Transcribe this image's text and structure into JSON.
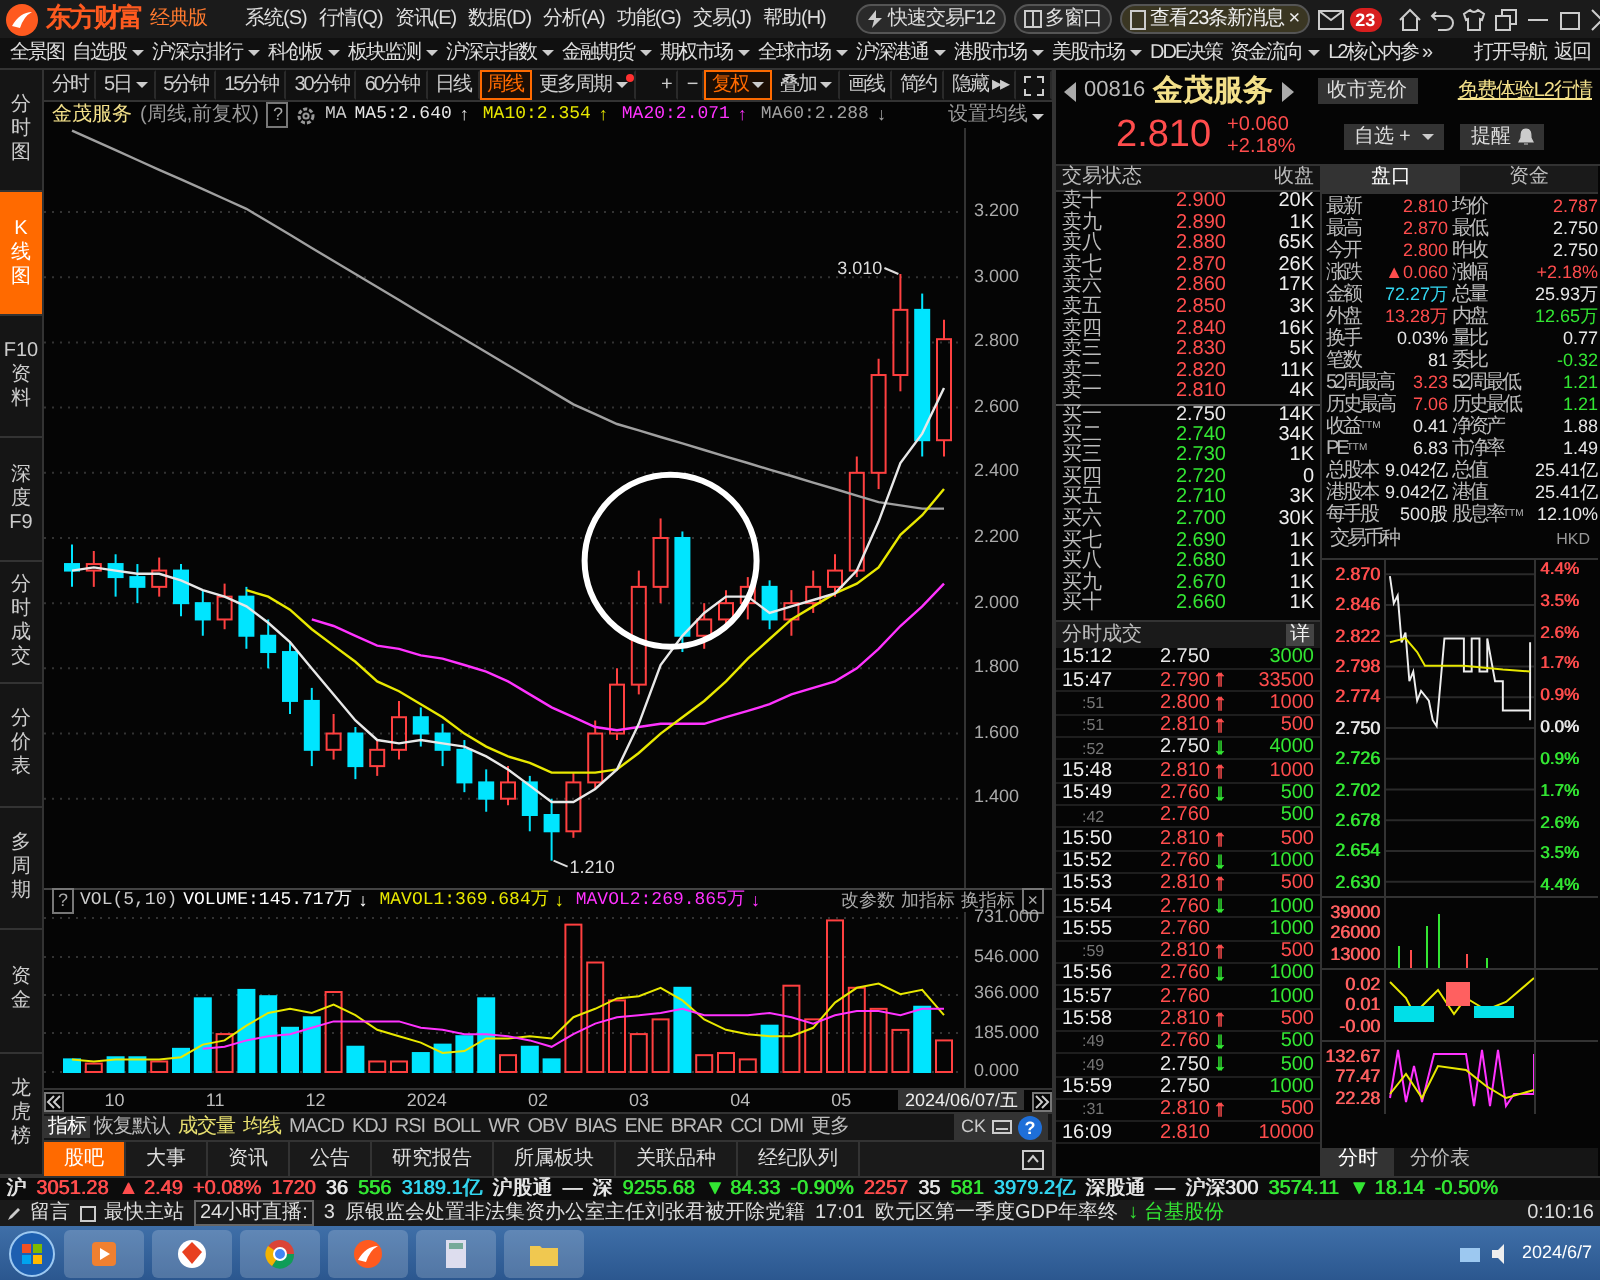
{
  "top_bar": {
    "brand": "东方财富",
    "edition": "经典版",
    "menu": [
      "系统(S)",
      "行情(Q)",
      "资讯(E)",
      "数据(D)",
      "分析(A)",
      "功能(G)",
      "交易(J)",
      "帮助(H)"
    ],
    "quick_trade": "快速交易F12",
    "multi_window": "多窗口",
    "messages": "查看23条新消息",
    "messages_close": "×",
    "mail_badge": "23"
  },
  "nav": [
    {
      "label": "全景图",
      "dropdown": false
    },
    {
      "label": "自选股",
      "dropdown": true
    },
    {
      "label": "沪深京排行",
      "dropdown": true
    },
    {
      "label": "科创板",
      "dropdown": true
    },
    {
      "label": "板块监测",
      "dropdown": true
    },
    {
      "label": "沪深京指数",
      "dropdown": true
    },
    {
      "label": "金融期货",
      "dropdown": true
    },
    {
      "label": "期权市场",
      "dropdown": true
    },
    {
      "label": "全球市场",
      "dropdown": true
    },
    {
      "label": "沪深港通",
      "dropdown": true
    },
    {
      "label": "港股市场",
      "dropdown": true
    },
    {
      "label": "美股市场",
      "dropdown": true
    },
    {
      "label": "DDE决策",
      "dropdown": false
    },
    {
      "label": "资金流向",
      "dropdown": true
    },
    {
      "label": "L2核心内参 »",
      "dropdown": false
    },
    {
      "label": "打开导航",
      "dropdown": false
    },
    {
      "label": "返回",
      "dropdown": false
    }
  ],
  "sidebar": [
    {
      "label": "分时图",
      "selected": false
    },
    {
      "label": "K线图",
      "selected": true
    },
    {
      "label": "F10资料",
      "selected": false
    },
    {
      "label": "深度F9",
      "selected": false
    },
    {
      "label": "分时成交",
      "selected": false
    },
    {
      "label": "分价表",
      "selected": false
    },
    {
      "label": "多周期",
      "selected": false
    },
    {
      "label": "资金",
      "selected": false
    },
    {
      "label": "龙虎榜",
      "selected": false
    }
  ],
  "periods": [
    {
      "label": "分时",
      "dropdown": false,
      "selected": false,
      "new_dot": false
    },
    {
      "label": "5日",
      "dropdown": true,
      "selected": false,
      "new_dot": false
    },
    {
      "label": "5分钟",
      "dropdown": false,
      "selected": false,
      "new_dot": false
    },
    {
      "label": "15分钟",
      "dropdown": false,
      "selected": false,
      "new_dot": false
    },
    {
      "label": "30分钟",
      "dropdown": false,
      "selected": false,
      "new_dot": false
    },
    {
      "label": "60分钟",
      "dropdown": false,
      "selected": false,
      "new_dot": false
    },
    {
      "label": "日线",
      "dropdown": false,
      "selected": false,
      "new_dot": false
    },
    {
      "label": "周线",
      "dropdown": false,
      "selected": true,
      "new_dot": false
    },
    {
      "label": "更多周期",
      "dropdown": true,
      "selected": false,
      "new_dot": true
    }
  ],
  "tools": [
    {
      "label": "+",
      "dropdown": false,
      "selected": false
    },
    {
      "label": "−",
      "dropdown": false,
      "selected": false
    },
    {
      "label": "复权",
      "dropdown": true,
      "selected": true
    },
    {
      "label": "叠加",
      "dropdown": true,
      "selected": false
    },
    {
      "label": "画线",
      "dropdown": false,
      "selected": false
    },
    {
      "label": "简约",
      "dropdown": false,
      "selected": false
    },
    {
      "label": "隐藏 ▸▸",
      "dropdown": false,
      "selected": false
    }
  ],
  "legend": {
    "name": "金茂服务",
    "mode": "(周线,前复权)",
    "help": "?",
    "ma_label": "MA",
    "mas": [
      {
        "value": ":2.640",
        "arrow": "↑"
      },
      {
        "value": ":2.354",
        "arrow": "↑"
      },
      {
        "value": ":2.071",
        "arrow": "↑"
      },
      {
        "value": ":2.288",
        "arrow": "↓"
      }
    ],
    "settings": "设置均线"
  },
  "kline": {
    "high_label": "3.010",
    "low_label": "1.210",
    "annotation": {
      "kind": "circle"
    },
    "chart_data": {
      "type": "candlestick",
      "grid": true,
      "ylim": [
        1.126,
        3.458
      ],
      "yticks": [
        {
          "value": 3.2,
          "label": "3.200"
        },
        {
          "value": 3.0,
          "label": "3.000"
        },
        {
          "value": 2.8,
          "label": "2.800"
        },
        {
          "value": 2.6,
          "label": "2.600"
        },
        {
          "value": 2.4,
          "label": "2.400"
        },
        {
          "value": 2.2,
          "label": "2.200"
        },
        {
          "value": 2.0,
          "label": "2.000"
        },
        {
          "value": 1.8,
          "label": "1.800"
        },
        {
          "value": 1.6,
          "label": "1.600"
        },
        {
          "value": 1.4,
          "label": "1.400"
        }
      ],
      "ohlc": [
        [
          2.12,
          2.18,
          2.05,
          2.1
        ],
        [
          2.1,
          2.16,
          2.05,
          2.12
        ],
        [
          2.12,
          2.15,
          2.02,
          2.08
        ],
        [
          2.08,
          2.12,
          2.0,
          2.05
        ],
        [
          2.05,
          2.14,
          2.02,
          2.1
        ],
        [
          2.1,
          2.12,
          1.96,
          2.0
        ],
        [
          2.0,
          2.04,
          1.9,
          1.95
        ],
        [
          1.95,
          2.06,
          1.92,
          2.02
        ],
        [
          2.02,
          2.05,
          1.86,
          1.9
        ],
        [
          1.9,
          1.95,
          1.8,
          1.85
        ],
        [
          1.85,
          1.88,
          1.66,
          1.7
        ],
        [
          1.7,
          1.74,
          1.5,
          1.55
        ],
        [
          1.55,
          1.66,
          1.52,
          1.6
        ],
        [
          1.6,
          1.62,
          1.46,
          1.5
        ],
        [
          1.5,
          1.58,
          1.47,
          1.55
        ],
        [
          1.55,
          1.7,
          1.52,
          1.65
        ],
        [
          1.65,
          1.68,
          1.56,
          1.6
        ],
        [
          1.6,
          1.63,
          1.5,
          1.55
        ],
        [
          1.55,
          1.58,
          1.42,
          1.45
        ],
        [
          1.45,
          1.49,
          1.36,
          1.4
        ],
        [
          1.4,
          1.5,
          1.38,
          1.45
        ],
        [
          1.45,
          1.47,
          1.3,
          1.35
        ],
        [
          1.35,
          1.4,
          1.21,
          1.3
        ],
        [
          1.3,
          1.48,
          1.28,
          1.45
        ],
        [
          1.45,
          1.64,
          1.43,
          1.6
        ],
        [
          1.6,
          1.8,
          1.58,
          1.75
        ],
        [
          1.75,
          2.1,
          1.72,
          2.05
        ],
        [
          2.05,
          2.26,
          2.0,
          2.2
        ],
        [
          2.2,
          2.22,
          1.85,
          1.9
        ],
        [
          1.9,
          2.0,
          1.86,
          1.95
        ],
        [
          1.95,
          2.04,
          1.92,
          2.0
        ],
        [
          2.0,
          2.08,
          1.95,
          2.05
        ],
        [
          2.05,
          2.07,
          1.92,
          1.95
        ],
        [
          1.95,
          2.04,
          1.9,
          2.0
        ],
        [
          2.0,
          2.1,
          1.97,
          2.05
        ],
        [
          2.05,
          2.15,
          2.02,
          2.1
        ],
        [
          2.1,
          2.45,
          2.08,
          2.4
        ],
        [
          2.4,
          2.75,
          2.35,
          2.7
        ],
        [
          2.7,
          3.01,
          2.65,
          2.9
        ],
        [
          2.9,
          2.95,
          2.45,
          2.5
        ],
        [
          2.5,
          2.87,
          2.45,
          2.81
        ]
      ],
      "series": [
        {
          "name": "MA5",
          "type": "line",
          "color": "#e8e8e8",
          "values": [
            2.1,
            2.11,
            2.1,
            2.09,
            2.09,
            2.07,
            2.04,
            2.02,
            1.99,
            1.94,
            1.88,
            1.8,
            1.72,
            1.64,
            1.58,
            1.57,
            1.58,
            1.57,
            1.56,
            1.53,
            1.49,
            1.44,
            1.39,
            1.39,
            1.43,
            1.49,
            1.63,
            1.81,
            1.9,
            1.97,
            2.02,
            2.02,
            1.97,
            1.99,
            2.01,
            2.03,
            2.1,
            2.25,
            2.43,
            2.52,
            2.66
          ]
        },
        {
          "name": "MA10",
          "type": "line",
          "color": "#e8e800",
          "values": [
            null,
            null,
            null,
            null,
            null,
            null,
            null,
            null,
            2.04,
            2.02,
            1.98,
            1.92,
            1.87,
            1.82,
            1.76,
            1.73,
            1.69,
            1.65,
            1.6,
            1.56,
            1.53,
            1.51,
            1.48,
            1.48,
            1.48,
            1.49,
            1.54,
            1.6,
            1.65,
            1.7,
            1.76,
            1.83,
            1.89,
            1.95,
            1.99,
            2.03,
            2.06,
            2.11,
            2.21,
            2.27,
            2.35
          ]
        },
        {
          "name": "MA20",
          "type": "line",
          "color": "#ff33ff",
          "values": [
            null,
            null,
            null,
            null,
            null,
            null,
            null,
            null,
            null,
            null,
            null,
            1.95,
            1.93,
            1.9,
            1.87,
            1.86,
            1.84,
            1.83,
            1.81,
            1.79,
            1.76,
            1.72,
            1.68,
            1.65,
            1.62,
            1.61,
            1.62,
            1.63,
            1.63,
            1.63,
            1.65,
            1.67,
            1.69,
            1.72,
            1.74,
            1.76,
            1.8,
            1.86,
            1.93,
            1.99,
            2.06
          ]
        },
        {
          "name": "MA60",
          "type": "line",
          "color": "#a0a0a0",
          "values": [
            3.45,
            3.42,
            3.39,
            3.36,
            3.33,
            3.3,
            3.27,
            3.24,
            3.21,
            3.17,
            3.13,
            3.09,
            3.05,
            3.01,
            2.97,
            2.93,
            2.89,
            2.85,
            2.81,
            2.77,
            2.73,
            2.69,
            2.65,
            2.61,
            2.58,
            2.55,
            2.53,
            2.51,
            2.49,
            2.47,
            2.45,
            2.43,
            2.41,
            2.39,
            2.37,
            2.35,
            2.33,
            2.31,
            2.3,
            2.29,
            2.29
          ]
        }
      ]
    }
  },
  "volume": {
    "help": "?",
    "title": "VOL(5,10)",
    "items": [
      {
        "value": ":145.717万",
        "arrow": "↓"
      },
      {
        "value": ":369.684万",
        "arrow": "↓"
      },
      {
        "value": ":269.865万",
        "arrow": "↓"
      }
    ],
    "actions": [
      "改参数",
      "加指标",
      "换指标"
    ],
    "close": "×",
    "chart_data": {
      "type": "bar",
      "grid": true,
      "ylim": [
        0,
        760
      ],
      "yticks": [
        {
          "value": 731,
          "label": "731.000"
        },
        {
          "value": 546,
          "label": "546.000"
        },
        {
          "value": 366,
          "label": "366.000"
        },
        {
          "value": 185,
          "label": "185.000"
        },
        {
          "value": 0,
          "label": "0.000"
        }
      ],
      "series": [
        {
          "name": "VOLUME",
          "colors": [
            "#00e5ff",
            "#ff4040",
            "#00e5ff",
            "#00e5ff",
            "#ff4040",
            "#00e5ff",
            "#00e5ff",
            "#ff4040",
            "#00e5ff",
            "#00e5ff",
            "#00e5ff",
            "#00e5ff",
            "#ff4040",
            "#00e5ff",
            "#ff4040",
            "#ff4040",
            "#00e5ff",
            "#00e5ff",
            "#00e5ff",
            "#00e5ff",
            "#ff4040",
            "#00e5ff",
            "#00e5ff",
            "#ff4040",
            "#ff4040",
            "#ff4040",
            "#ff4040",
            "#ff4040",
            "#00e5ff",
            "#ff4040",
            "#ff4040",
            "#ff4040",
            "#00e5ff",
            "#ff4040",
            "#ff4040",
            "#ff4040",
            "#ff4040",
            "#ff4040",
            "#ff4040",
            "#00e5ff",
            "#ff4040"
          ],
          "values": [
            60,
            40,
            70,
            70,
            50,
            110,
            350,
            180,
            390,
            360,
            210,
            260,
            380,
            120,
            50,
            50,
            90,
            130,
            170,
            350,
            80,
            120,
            60,
            700,
            520,
            340,
            180,
            250,
            400,
            80,
            90,
            60,
            220,
            410,
            250,
            720,
            400,
            300,
            200,
            310,
            150
          ]
        },
        {
          "name": "MAVOL1",
          "type": "line",
          "color": "#e8e800",
          "values": [
            60,
            50,
            60,
            60,
            60,
            70,
            130,
            150,
            220,
            280,
            300,
            280,
            320,
            270,
            200,
            170,
            140,
            90,
            100,
            160,
            160,
            170,
            160,
            260,
            300,
            350,
            360,
            400,
            340,
            250,
            200,
            180,
            170,
            170,
            210,
            330,
            400,
            420,
            370,
            390,
            270
          ]
        },
        {
          "name": "MAVOL2",
          "type": "line",
          "color": "#ff33ff",
          "values": [
            null,
            null,
            null,
            null,
            null,
            null,
            110,
            120,
            150,
            170,
            180,
            210,
            240,
            240,
            240,
            240,
            210,
            200,
            180,
            180,
            170,
            150,
            120,
            180,
            230,
            260,
            270,
            280,
            300,
            270,
            270,
            270,
            280,
            260,
            230,
            270,
            290,
            290,
            270,
            300,
            300
          ]
        }
      ]
    }
  },
  "x_labels": [
    "10",
    "11",
    "12",
    "2024",
    "02",
    "03",
    "04",
    "05"
  ],
  "cursor_date": "2024/06/07/五",
  "indicator_tabs": [
    {
      "label": "指标",
      "selected": true
    },
    {
      "label": "恢复默认",
      "selected": false
    },
    {
      "label": "成交量",
      "selected": false
    },
    {
      "label": "均线",
      "selected": false
    },
    {
      "label": "MACD",
      "selected": false
    },
    {
      "label": "KDJ",
      "selected": false
    },
    {
      "label": "RSI",
      "selected": false
    },
    {
      "label": "BOLL",
      "selected": false
    },
    {
      "label": "WR",
      "selected": false
    },
    {
      "label": "OBV",
      "selected": false
    },
    {
      "label": "BIAS",
      "selected": false
    },
    {
      "label": "ENE",
      "selected": false
    },
    {
      "label": "BRAR",
      "selected": false
    },
    {
      "label": "CCI",
      "selected": false
    },
    {
      "label": "DMI",
      "selected": false
    },
    {
      "label": "更多",
      "selected": false
    }
  ],
  "ck_widget": {
    "label": "CK",
    "help": "?"
  },
  "bottom_tabs": [
    {
      "label": "股吧",
      "selected": true
    },
    {
      "label": "大事",
      "selected": false
    },
    {
      "label": "资讯",
      "selected": false
    },
    {
      "label": "公告",
      "selected": false
    },
    {
      "label": "研究报告",
      "selected": false
    },
    {
      "label": "所属板块",
      "selected": false
    },
    {
      "label": "关联品种",
      "selected": false
    },
    {
      "label": "经纪队列",
      "selected": false
    }
  ],
  "quote": {
    "code": "00816",
    "name": "金茂服务",
    "auction": "收市竞价",
    "l2_link": "免费体验L2行情",
    "price": "2.810",
    "change": "+0.060",
    "change_pct": "+2.18%",
    "watch": "自选 +",
    "alert": "提醒"
  },
  "order_book": {
    "status_label": "交易状态",
    "status": "收盘",
    "asks": [
      {
        "label": "卖十",
        "price": "2.900",
        "volume": "20K",
        "color": "#ff4d4d"
      },
      {
        "label": "卖九",
        "price": "2.890",
        "volume": "1K",
        "color": "#ff4d4d"
      },
      {
        "label": "卖八",
        "price": "2.880",
        "volume": "65K",
        "color": "#ff4d4d"
      },
      {
        "label": "卖七",
        "price": "2.870",
        "volume": "26K",
        "color": "#ff4d4d"
      },
      {
        "label": "卖六",
        "price": "2.860",
        "volume": "17K",
        "color": "#ff4d4d"
      },
      {
        "label": "卖五",
        "price": "2.850",
        "volume": "3K",
        "color": "#ff4d4d"
      },
      {
        "label": "卖四",
        "price": "2.840",
        "volume": "16K",
        "color": "#ff4d4d"
      },
      {
        "label": "卖三",
        "price": "2.830",
        "volume": "5K",
        "color": "#ff4d4d"
      },
      {
        "label": "卖二",
        "price": "2.820",
        "volume": "11K",
        "color": "#ff4d4d"
      },
      {
        "label": "卖一",
        "price": "2.810",
        "volume": "4K",
        "color": "#ff4d4d"
      }
    ],
    "bids": [
      {
        "label": "买一",
        "price": "2.750",
        "volume": "14K",
        "color": "#e6e6e6"
      },
      {
        "label": "买二",
        "price": "2.740",
        "volume": "34K",
        "color": "#33e633"
      },
      {
        "label": "买三",
        "price": "2.730",
        "volume": "1K",
        "color": "#33e633"
      },
      {
        "label": "买四",
        "price": "2.720",
        "volume": "0",
        "color": "#33e633"
      },
      {
        "label": "买五",
        "price": "2.710",
        "volume": "3K",
        "color": "#33e633"
      },
      {
        "label": "买六",
        "price": "2.700",
        "volume": "30K",
        "color": "#33e633"
      },
      {
        "label": "买七",
        "price": "2.690",
        "volume": "1K",
        "color": "#33e633"
      },
      {
        "label": "买八",
        "price": "2.680",
        "volume": "1K",
        "color": "#33e633"
      },
      {
        "label": "买九",
        "price": "2.670",
        "volume": "1K",
        "color": "#33e633"
      },
      {
        "label": "买十",
        "price": "2.660",
        "volume": "1K",
        "color": "#33e633"
      }
    ]
  },
  "stats_tabs": [
    {
      "label": "盘口",
      "selected": true
    },
    {
      "label": "资金",
      "selected": false
    }
  ],
  "stats": [
    {
      "label": "最新",
      "value": "2.810",
      "color": "#ff4d4d"
    },
    {
      "label": "均价",
      "value": "2.787",
      "color": "#ff4d4d"
    },
    {
      "label": "最高",
      "value": "2.870",
      "color": "#ff4d4d"
    },
    {
      "label": "最低",
      "value": "2.750",
      "color": "#e6e6e6"
    },
    {
      "label": "今开",
      "value": "2.800",
      "color": "#ff4d4d"
    },
    {
      "label": "昨收",
      "value": "2.750",
      "color": "#e6e6e6"
    },
    {
      "label": "涨跌",
      "value": "▲0.060",
      "color": "#ff4d4d"
    },
    {
      "label": "涨幅",
      "value": "+2.18%",
      "color": "#ff4d4d"
    },
    {
      "label": "金额",
      "value": "72.27万",
      "color": "#33d6f0"
    },
    {
      "label": "总量",
      "value": "25.93万",
      "color": "#e6e6e6"
    },
    {
      "label": "外盘",
      "value": "13.28万",
      "color": "#ff4d4d"
    },
    {
      "label": "内盘",
      "value": "12.65万",
      "color": "#33e633"
    },
    {
      "label": "换手",
      "value": "0.03%",
      "color": "#e6e6e6"
    },
    {
      "label": "量比",
      "value": "0.77",
      "color": "#e6e6e6"
    },
    {
      "label": "笔数",
      "value": "81",
      "color": "#e6e6e6"
    },
    {
      "label": "委比",
      "value": "-0.32",
      "color": "#33e633"
    },
    {
      "label": "52周最高",
      "value": "3.23",
      "color": "#ff4d4d"
    },
    {
      "label": "52周最低",
      "value": "1.21",
      "color": "#33e633"
    },
    {
      "label": "历史最高",
      "value": "7.06",
      "color": "#ff4d4d"
    },
    {
      "label": "历史最低",
      "value": "1.21",
      "color": "#33e633"
    },
    {
      "label": "收益$^{TTM}$",
      "value": "0.41",
      "color": "#e6e6e6"
    },
    {
      "label": "净资产",
      "value": "1.88",
      "color": "#e6e6e6"
    },
    {
      "label": "PE$^{TTM}$",
      "value": "6.83",
      "color": "#e6e6e6"
    },
    {
      "label": "市净率",
      "value": "1.49",
      "color": "#e6e6e6"
    },
    {
      "label": "总股本",
      "value": "9.042亿",
      "color": "#e6e6e6"
    },
    {
      "label": "总值",
      "value": "25.41亿",
      "color": "#e6e6e6"
    },
    {
      "label": "港股本",
      "value": "9.042亿",
      "color": "#e6e6e6"
    },
    {
      "label": "港值",
      "value": "25.41亿",
      "color": "#e6e6e6"
    },
    {
      "label": "每手股",
      "value": "500股",
      "color": "#e6e6e6"
    },
    {
      "label": "股息率$^{TTM}$",
      "value": "12.10%",
      "color": "#e6e6e6"
    }
  ],
  "currency": {
    "label": "交易币种",
    "value": "HKD"
  },
  "trades_header": {
    "title": "分时成交",
    "detail": "详"
  },
  "trades": [
    {
      "time": "15:12",
      "sub": false,
      "price": "2.750",
      "color": "#e6e6e6",
      "volume": {
        "text": "3000",
        "color": "#33e633"
      }
    },
    {
      "time": "15:47",
      "sub": false,
      "price": "2.790",
      "color": "#ff4d4d",
      "arrow": {
        "text": "↑",
        "color": "#ff4d4d"
      },
      "volume": {
        "text": "33500",
        "color": "#ff4d4d"
      }
    },
    {
      "time": ":51",
      "sub": true,
      "price": "2.800",
      "color": "#ff4d4d",
      "arrow": {
        "text": "↑",
        "color": "#ff4d4d"
      },
      "volume": {
        "text": "1000",
        "color": "#ff4d4d"
      }
    },
    {
      "time": ":51",
      "sub": true,
      "price": "2.810",
      "color": "#ff4d4d",
      "arrow": {
        "text": "↑",
        "color": "#ff4d4d"
      },
      "volume": {
        "text": "500",
        "color": "#ff4d4d"
      }
    },
    {
      "time": ":52",
      "sub": true,
      "price": "2.750",
      "color": "#e6e6e6",
      "arrow": {
        "text": "↓",
        "color": "#33e633"
      },
      "volume": {
        "text": "4000",
        "color": "#33e633"
      }
    },
    {
      "time": "15:48",
      "sub": false,
      "price": "2.810",
      "color": "#ff4d4d",
      "arrow": {
        "text": "↑",
        "color": "#ff4d4d"
      },
      "volume": {
        "text": "1000",
        "color": "#ff4d4d"
      }
    },
    {
      "time": "15:49",
      "sub": false,
      "price": "2.760",
      "color": "#ff4d4d",
      "arrow": {
        "text": "↓",
        "color": "#33e633"
      },
      "volume": {
        "text": "500",
        "color": "#33e633"
      }
    },
    {
      "time": ":42",
      "sub": true,
      "price": "2.760",
      "color": "#ff4d4d",
      "volume": {
        "text": "500",
        "color": "#33e633"
      }
    },
    {
      "time": "15:50",
      "sub": false,
      "price": "2.810",
      "color": "#ff4d4d",
      "arrow": {
        "text": "↑",
        "color": "#ff4d4d"
      },
      "volume": {
        "text": "500",
        "color": "#ff4d4d"
      }
    },
    {
      "time": "15:52",
      "sub": false,
      "price": "2.760",
      "color": "#ff4d4d",
      "arrow": {
        "text": "↓",
        "color": "#33e633"
      },
      "volume": {
        "text": "1000",
        "color": "#33e633"
      }
    },
    {
      "time": "15:53",
      "sub": false,
      "price": "2.810",
      "color": "#ff4d4d",
      "arrow": {
        "text": "↑",
        "color": "#ff4d4d"
      },
      "volume": {
        "text": "500",
        "color": "#ff4d4d"
      }
    },
    {
      "time": "15:54",
      "sub": false,
      "price": "2.760",
      "color": "#ff4d4d",
      "arrow": {
        "text": "↓",
        "color": "#33e633"
      },
      "volume": {
        "text": "1000",
        "color": "#33e633"
      }
    },
    {
      "time": "15:55",
      "sub": false,
      "price": "2.760",
      "color": "#ff4d4d",
      "volume": {
        "text": "1000",
        "color": "#33e633"
      }
    },
    {
      "time": ":59",
      "sub": true,
      "price": "2.810",
      "color": "#ff4d4d",
      "arrow": {
        "text": "↑",
        "color": "#ff4d4d"
      },
      "volume": {
        "text": "500",
        "color": "#ff4d4d"
      }
    },
    {
      "time": "15:56",
      "sub": false,
      "price": "2.760",
      "color": "#ff4d4d",
      "arrow": {
        "text": "↓",
        "color": "#33e633"
      },
      "volume": {
        "text": "1000",
        "color": "#33e633"
      }
    },
    {
      "time": "15:57",
      "sub": false,
      "price": "2.760",
      "color": "#ff4d4d",
      "volume": {
        "text": "1000",
        "color": "#33e633"
      }
    },
    {
      "time": "15:58",
      "sub": false,
      "price": "2.810",
      "color": "#ff4d4d",
      "arrow": {
        "text": "↑",
        "color": "#ff4d4d"
      },
      "volume": {
        "text": "500",
        "color": "#ff4d4d"
      }
    },
    {
      "time": ":49",
      "sub": true,
      "price": "2.760",
      "color": "#ff4d4d",
      "arrow": {
        "text": "↓",
        "color": "#33e633"
      },
      "volume": {
        "text": "500",
        "color": "#33e633"
      }
    },
    {
      "time": ":49",
      "sub": true,
      "price": "2.750",
      "color": "#e6e6e6",
      "arrow": {
        "text": "↓",
        "color": "#33e633"
      },
      "volume": {
        "text": "500",
        "color": "#33e633"
      }
    },
    {
      "time": "15:59",
      "sub": false,
      "price": "2.750",
      "color": "#e6e6e6",
      "volume": {
        "text": "1000",
        "color": "#33e633"
      }
    },
    {
      "time": ":31",
      "sub": true,
      "price": "2.810",
      "color": "#ff4d4d",
      "arrow": {
        "text": "↑",
        "color": "#ff4d4d"
      },
      "volume": {
        "text": "500",
        "color": "#ff4d4d"
      }
    },
    {
      "time": "16:09",
      "sub": false,
      "price": "2.810",
      "color": "#ff4d4d",
      "volume": {
        "text": "10000",
        "color": "#ff4d4d"
      }
    }
  ],
  "intraday": {
    "prices": [
      {
        "label": "2.870",
        "color": "#ff4d4d"
      },
      {
        "label": "2.846",
        "color": "#ff4d4d"
      },
      {
        "label": "2.822",
        "color": "#ff4d4d"
      },
      {
        "label": "2.798",
        "color": "#ff4d4d"
      },
      {
        "label": "2.774",
        "color": "#ff4d4d"
      },
      {
        "label": "2.750",
        "color": "#e6e6e6"
      },
      {
        "label": "2.726",
        "color": "#33e633"
      },
      {
        "label": "2.702",
        "color": "#33e633"
      },
      {
        "label": "2.678",
        "color": "#33e633"
      },
      {
        "label": "2.654",
        "color": "#33e633"
      },
      {
        "label": "2.630",
        "color": "#33e633"
      }
    ],
    "percents": [
      {
        "label": "4.4%",
        "color": "#ff4d4d"
      },
      {
        "label": "3.5%",
        "color": "#ff4d4d"
      },
      {
        "label": "2.6%",
        "color": "#ff4d4d"
      },
      {
        "label": "1.7%",
        "color": "#ff4d4d"
      },
      {
        "label": "0.9%",
        "color": "#ff4d4d"
      },
      {
        "label": "0.0%",
        "color": "#e6e6e6"
      },
      {
        "label": "0.9%",
        "color": "#33e633"
      },
      {
        "label": "1.7%",
        "color": "#33e633"
      },
      {
        "label": "2.6%",
        "color": "#33e633"
      },
      {
        "label": "3.5%",
        "color": "#33e633"
      },
      {
        "label": "4.4%",
        "color": "#33e633"
      }
    ],
    "volume_ticks": [
      "39000",
      "26000",
      "13000"
    ],
    "macd_ticks": [
      "0.02",
      "0.01",
      "-0.00"
    ],
    "kdj_ticks": [
      "132.67",
      "77.47",
      "22.28"
    ],
    "tabs": [
      {
        "label": "分时",
        "selected": true
      },
      {
        "label": "分价表",
        "selected": false
      }
    ]
  },
  "status_line": [
    {
      "text": "沪",
      "color": "#e6e6e6"
    },
    {
      "text": "3051.28",
      "color": "#ff4d4d"
    },
    {
      "text": "▲ 2.49",
      "color": "#ff4d4d"
    },
    {
      "text": "+0.08%",
      "color": "#ff4d4d"
    },
    {
      "text": "1720",
      "color": "#ff4d4d"
    },
    {
      "text": "36",
      "color": "#e6e6e6"
    },
    {
      "text": "556",
      "color": "#33e633"
    },
    {
      "text": "3189.1亿",
      "color": "#33d6f0"
    },
    {
      "text": "沪股通",
      "color": "#e6e6e6"
    },
    {
      "text": "—",
      "color": "#e6e6e6"
    },
    {
      "text": "深",
      "color": "#e6e6e6"
    },
    {
      "text": "9255.68",
      "color": "#33e633"
    },
    {
      "text": "▼ 84.33",
      "color": "#33e633"
    },
    {
      "text": "-0.90%",
      "color": "#33e633"
    },
    {
      "text": "2257",
      "color": "#ff4d4d"
    },
    {
      "text": "35",
      "color": "#e6e6e6"
    },
    {
      "text": "581",
      "color": "#33e633"
    },
    {
      "text": "3979.2亿",
      "color": "#33d6f0"
    },
    {
      "text": "深股通",
      "color": "#e6e6e6"
    },
    {
      "text": "—",
      "color": "#e6e6e6"
    },
    {
      "text": "沪深300",
      "color": "#e6e6e6"
    },
    {
      "text": "3574.11",
      "color": "#33e633"
    },
    {
      "text": "▼ 18.14",
      "color": "#33e633"
    },
    {
      "text": "-0.50%",
      "color": "#33e633"
    }
  ],
  "news_bar": {
    "message": "留言",
    "fastest": "最快主站",
    "live": "24小时直播:",
    "count": "3",
    "headline": "原银监会处置非法集资办公室主任刘张君被开除党籍",
    "time": "17:01",
    "headline_2": "欧元区第一季度GDP年率终",
    "alert": "↓ 台基股份",
    "clock": "0:10:16"
  },
  "taskbar": {
    "date": "2024/6/7"
  }
}
